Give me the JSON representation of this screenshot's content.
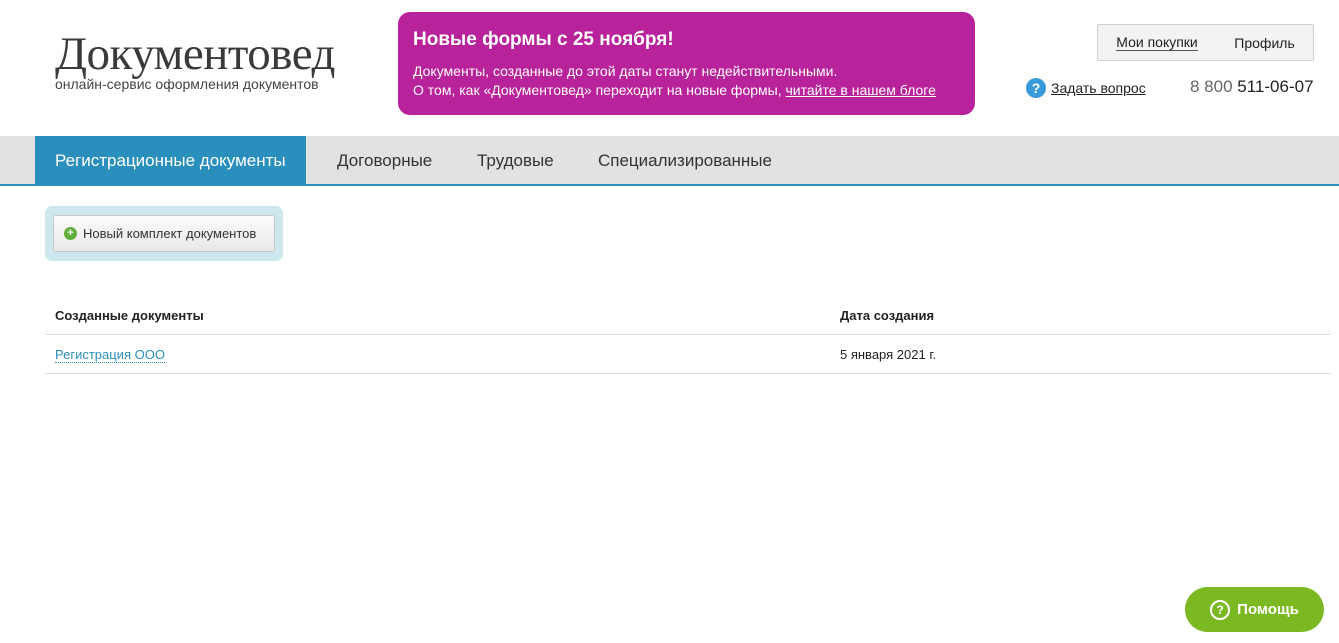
{
  "logo": {
    "title": "Документовед",
    "subtitle": "онлайн-сервис оформления документов"
  },
  "promo": {
    "title": "Новые формы с 25 ноября!",
    "line1": "Документы, созданные до этой даты станут недействительными.",
    "line2_text": "О том, как «Документовед» переходит на новые формы, ",
    "line2_link": "читайте в нашем блоге",
    "bg_color": "#b8229a"
  },
  "user_menu": {
    "purchases": "Мои покупки",
    "profile": "Профиль"
  },
  "ask": {
    "icon": "question-circle-icon",
    "label": "Задать вопрос"
  },
  "phone": {
    "prefix": "8 800",
    "number": "511-06-07"
  },
  "nav": {
    "items": [
      {
        "label": "Регистрационные документы",
        "active": true
      },
      {
        "label": "Договорные"
      },
      {
        "label": "Трудовые"
      },
      {
        "label": "Специализированные"
      }
    ],
    "accent_color": "#2a8fbd"
  },
  "new_doc": {
    "icon": "plus-circle-icon",
    "label": "Новый комплект документов"
  },
  "table": {
    "headers": [
      "Созданные документы",
      "Дата создания"
    ],
    "rows": [
      {
        "name": "Регистрация ООО",
        "date": "5 января 2021 г."
      }
    ]
  },
  "help": {
    "icon": "question-circle-icon",
    "label": "Помощь",
    "color": "#7cb822"
  }
}
